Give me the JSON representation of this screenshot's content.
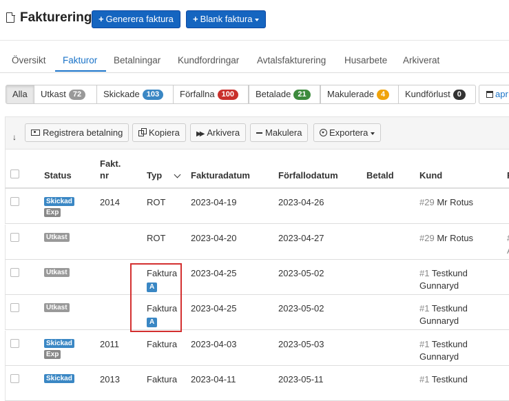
{
  "header": {
    "title": "Fakturering",
    "generate_button": "Generera faktura",
    "blank_button": "Blank faktura"
  },
  "tabs": [
    "Översikt",
    "Fakturor",
    "Betalningar",
    "Kundfordringar",
    "Avtalsfakturering",
    "Husarbete",
    "Arkiverat"
  ],
  "active_tab": "Fakturor",
  "filters": [
    {
      "label": "Alla",
      "count": null
    },
    {
      "label": "Utkast",
      "count": "72",
      "color": "#999999"
    },
    {
      "label": "Skickade",
      "count": "103",
      "color": "#3a87c4"
    },
    {
      "label": "Förfallna",
      "count": "100",
      "color": "#c9302c"
    },
    {
      "label": "Betalade",
      "count": "21",
      "color": "#3d8b3d"
    },
    {
      "label": "Makulerade",
      "count": "4",
      "color": "#f0a30a"
    },
    {
      "label": "Kundförlust",
      "count": "0",
      "color": "#333333"
    }
  ],
  "date_filter": "apr",
  "toolbar": {
    "register_payment": "Registrera betalning",
    "copy": "Kopiera",
    "archive": "Arkivera",
    "void": "Makulera",
    "export": "Exportera"
  },
  "table": {
    "headers": {
      "status": "Status",
      "fakt_nr_line1": "Fakt.",
      "fakt_nr_line2": "nr",
      "typ": "Typ",
      "fakturadatum": "Fakturadatum",
      "forfallodatum": "Förfallodatum",
      "betald": "Betald",
      "kund": "Kund",
      "last": "F"
    },
    "rows": [
      {
        "status": "Skickad",
        "status_color": "#3a87c4",
        "extra": "Exp",
        "nr": "2014",
        "typ": "ROT",
        "typ_tag": "",
        "fakturadatum": "2023-04-19",
        "forfallodatum": "2023-04-26",
        "betald": "",
        "kund_num": "#29",
        "kund_line1": "Mr Rotus",
        "kund_line2": "",
        "last1": "",
        "last2": ""
      },
      {
        "status": "Utkast",
        "status_color": "#999999",
        "extra": "",
        "nr": "",
        "typ": "ROT",
        "typ_tag": "",
        "fakturadatum": "2023-04-20",
        "forfallodatum": "2023-04-27",
        "betald": "",
        "kund_num": "#29",
        "kund_line1": "Mr Rotus",
        "kund_line2": "",
        "last1": "#",
        "last2": "A"
      },
      {
        "status": "Utkast",
        "status_color": "#999999",
        "extra": "",
        "nr": "",
        "typ": "Faktura",
        "typ_tag": "A",
        "fakturadatum": "2023-04-25",
        "forfallodatum": "2023-05-02",
        "betald": "",
        "kund_num": "#1",
        "kund_line1": "Testkund",
        "kund_line2": "Gunnaryd",
        "last1": "",
        "last2": ""
      },
      {
        "status": "Utkast",
        "status_color": "#999999",
        "extra": "",
        "nr": "",
        "typ": "Faktura",
        "typ_tag": "A",
        "fakturadatum": "2023-04-25",
        "forfallodatum": "2023-05-02",
        "betald": "",
        "kund_num": "#1",
        "kund_line1": "Testkund",
        "kund_line2": "Gunnaryd",
        "last1": "",
        "last2": ""
      },
      {
        "status": "Skickad",
        "status_color": "#3a87c4",
        "extra": "Exp",
        "nr": "2011",
        "typ": "Faktura",
        "typ_tag": "",
        "fakturadatum": "2023-04-03",
        "forfallodatum": "2023-05-03",
        "betald": "",
        "kund_num": "#1",
        "kund_line1": "Testkund",
        "kund_line2": "Gunnaryd",
        "last1": "",
        "last2": ""
      },
      {
        "status": "Skickad",
        "status_color": "#3a87c4",
        "extra": "",
        "nr": "2013",
        "typ": "Faktura",
        "typ_tag": "",
        "fakturadatum": "2023-04-11",
        "forfallodatum": "2023-05-11",
        "betald": "",
        "kund_num": "#1",
        "kund_line1": "Testkund",
        "kund_line2": "",
        "last1": "",
        "last2": ""
      }
    ]
  },
  "colors": {
    "primary": "#1565c0",
    "link": "#1a73c8",
    "exp_tag": "#888888",
    "highlight_box": "#d32f2f"
  }
}
